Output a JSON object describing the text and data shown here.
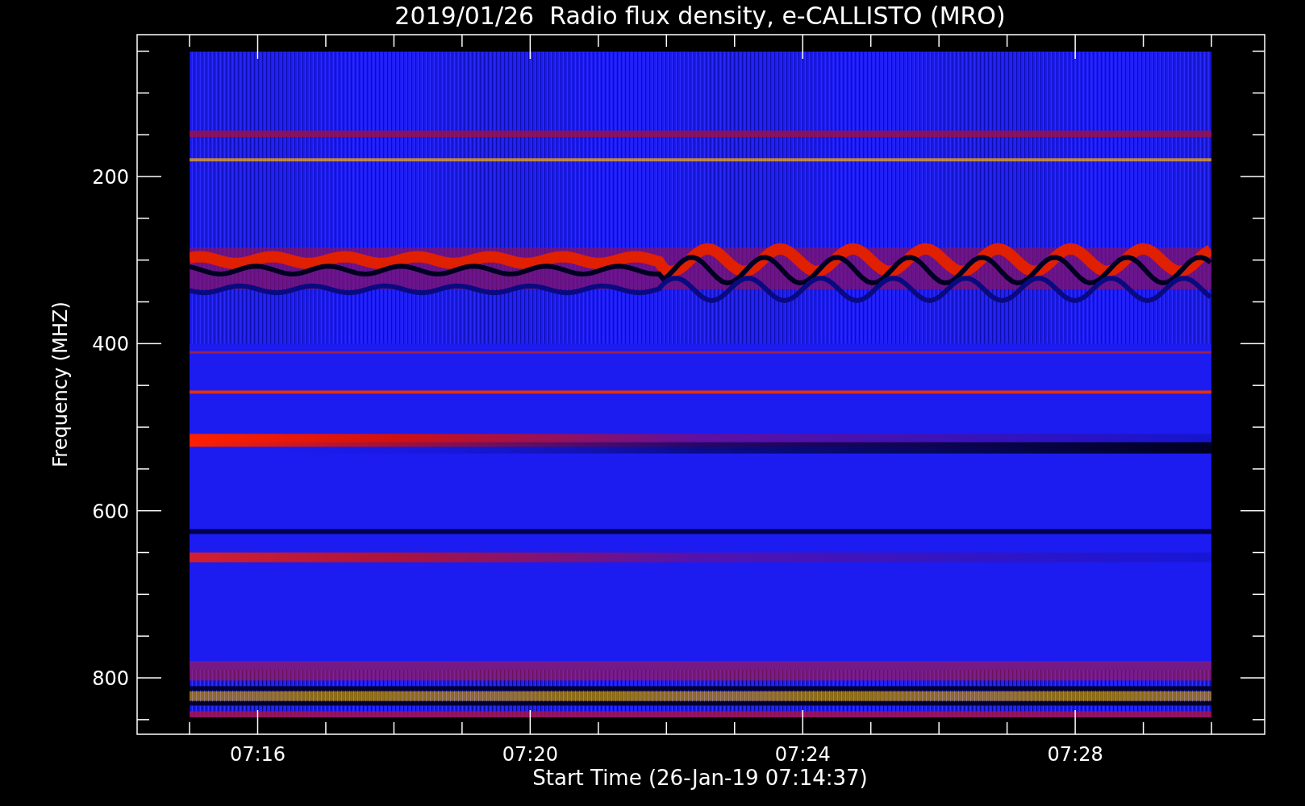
{
  "title": "2019/01/26  Radio flux density, e-CALLISTO (MRO)",
  "y_axis": {
    "label": "Frequency (MHZ)",
    "ticks": [
      "200",
      "400",
      "600",
      "800"
    ]
  },
  "x_axis": {
    "label": "Start Time (26-Jan-19 07:14:37)",
    "ticks": [
      "07:16",
      "07:20",
      "07:24",
      "07:28"
    ]
  }
}
